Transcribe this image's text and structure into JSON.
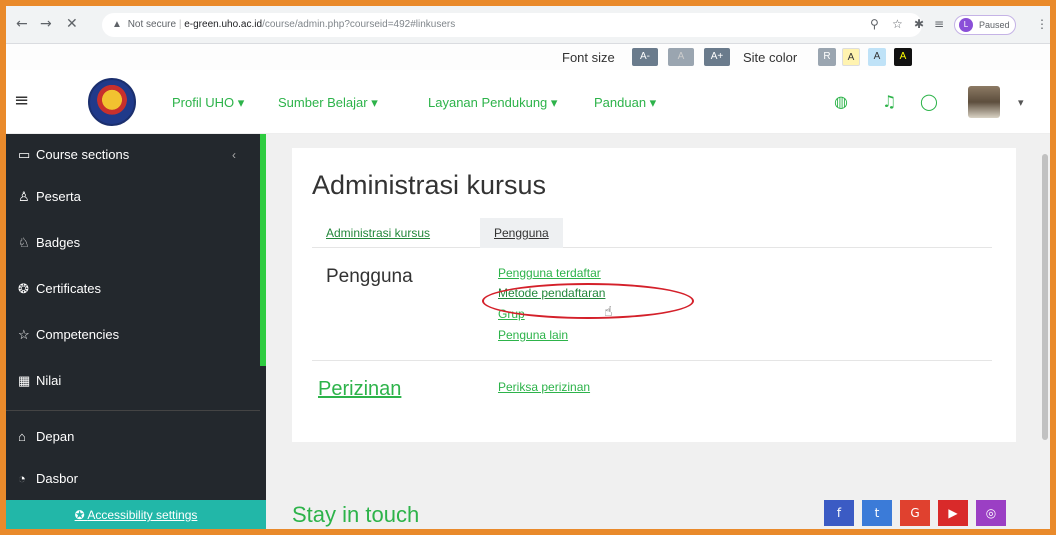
{
  "browser": {
    "security_label": "Not secure",
    "url_host": "e-green.uho.ac.id",
    "url_path": "/course/admin.php?courseid=492#linkusers",
    "profile_status": "Paused"
  },
  "a11y": {
    "font_size_label": "Font size",
    "font_buttons": [
      "A-",
      "A",
      "A+"
    ],
    "site_color_label": "Site color",
    "color_buttons": [
      "R",
      "A",
      "A",
      "A"
    ]
  },
  "nav": {
    "menu": [
      "Profil UHO ▾",
      "Sumber Belajar ▾",
      "Layanan Pendukung ▾",
      "Panduan ▾"
    ]
  },
  "sidebar": {
    "items": [
      {
        "icon": "folder-icon",
        "label": "Course sections"
      },
      {
        "icon": "people-icon",
        "label": "Peserta"
      },
      {
        "icon": "badge-icon",
        "label": "Badges"
      },
      {
        "icon": "certificate-icon",
        "label": "Certificates"
      },
      {
        "icon": "star-icon",
        "label": "Competencies"
      },
      {
        "icon": "grades-icon",
        "label": "Nilai"
      },
      {
        "icon": "home-icon",
        "label": "Depan"
      },
      {
        "icon": "dashboard-icon",
        "label": "Dasbor"
      }
    ],
    "accessibility_settings": "Accessibility settings"
  },
  "main": {
    "title": "Administrasi kursus",
    "tabs": [
      "Administrasi kursus",
      "Pengguna"
    ],
    "sections": {
      "pengguna": {
        "title": "Pengguna",
        "links": [
          "Pengguna terdaftar",
          "Metode pendaftaran",
          "Grup",
          "Penguna lain"
        ]
      },
      "perizinan": {
        "title": "Perizinan",
        "links": [
          "Periksa perizinan"
        ]
      }
    },
    "stay_in_touch": "Stay in touch"
  },
  "colors": {
    "accent_green": "#2db34a",
    "sidebar_bg": "#23282d",
    "highlight_red": "#d4202a",
    "frame_orange": "#e98a2b"
  }
}
